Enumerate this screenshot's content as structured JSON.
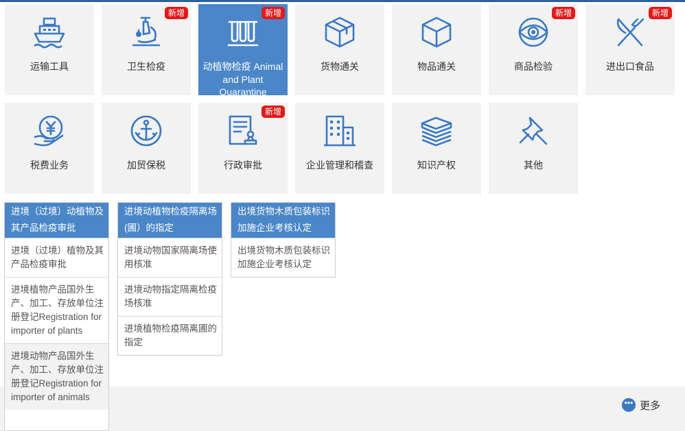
{
  "colors": {
    "accent": "#4a86c8",
    "icon": "#3a78c2",
    "badge": "#e11a1a",
    "tile_bg": "#f2f2f2"
  },
  "tiles": [
    {
      "label": "运输工具",
      "icon": "ship-icon",
      "badge": ""
    },
    {
      "label": "卫生检疫",
      "icon": "microscope-icon",
      "badge": "新增"
    },
    {
      "label": "动植物检疫 Animal and Plant Quarantine",
      "icon": "test-tubes-icon",
      "badge": "新增",
      "active": true
    },
    {
      "label": "货物通关",
      "icon": "box-icon",
      "badge": ""
    },
    {
      "label": "物品通关",
      "icon": "cube-icon",
      "badge": ""
    },
    {
      "label": "商品检验",
      "icon": "eye-icon",
      "badge": "新增"
    },
    {
      "label": "进出口食品",
      "icon": "fork-knife-icon",
      "badge": "新增"
    },
    {
      "label": "税费业务",
      "icon": "yen-hand-icon",
      "badge": ""
    },
    {
      "label": "加贸保税",
      "icon": "anchor-icon",
      "badge": ""
    },
    {
      "label": "行政审批",
      "icon": "document-stamp-icon",
      "badge": "新增"
    },
    {
      "label": "企业管理和稽查",
      "icon": "building-icon",
      "badge": ""
    },
    {
      "label": "知识产权",
      "icon": "books-icon",
      "badge": ""
    },
    {
      "label": "其他",
      "icon": "pushpin-icon",
      "badge": ""
    }
  ],
  "columns": [
    {
      "header": "进境（过境）动植物及其产品检疫审批",
      "items": [
        "进境（过境）植物及其产品检疫审批",
        "进境植物产品国外生产、加工、存放单位注册登记Registration for importer of plants",
        "进境动物产品国外生产、加工、存放单位注册登记Registration for importer of animals"
      ]
    },
    {
      "header": "进境动植物检疫隔离场(圃）的指定",
      "items": [
        "进境动物国家隔离场使用核准",
        "进境动物指定隔离检疫场核准",
        "进境植物检疫隔离圃的指定"
      ]
    },
    {
      "header": "出境货物木质包装标识加施企业考核认定",
      "items": [
        "出境货物木质包装标识加施企业考核认定"
      ]
    }
  ],
  "more": {
    "label": "更多",
    "icon": "more-dots-icon"
  }
}
